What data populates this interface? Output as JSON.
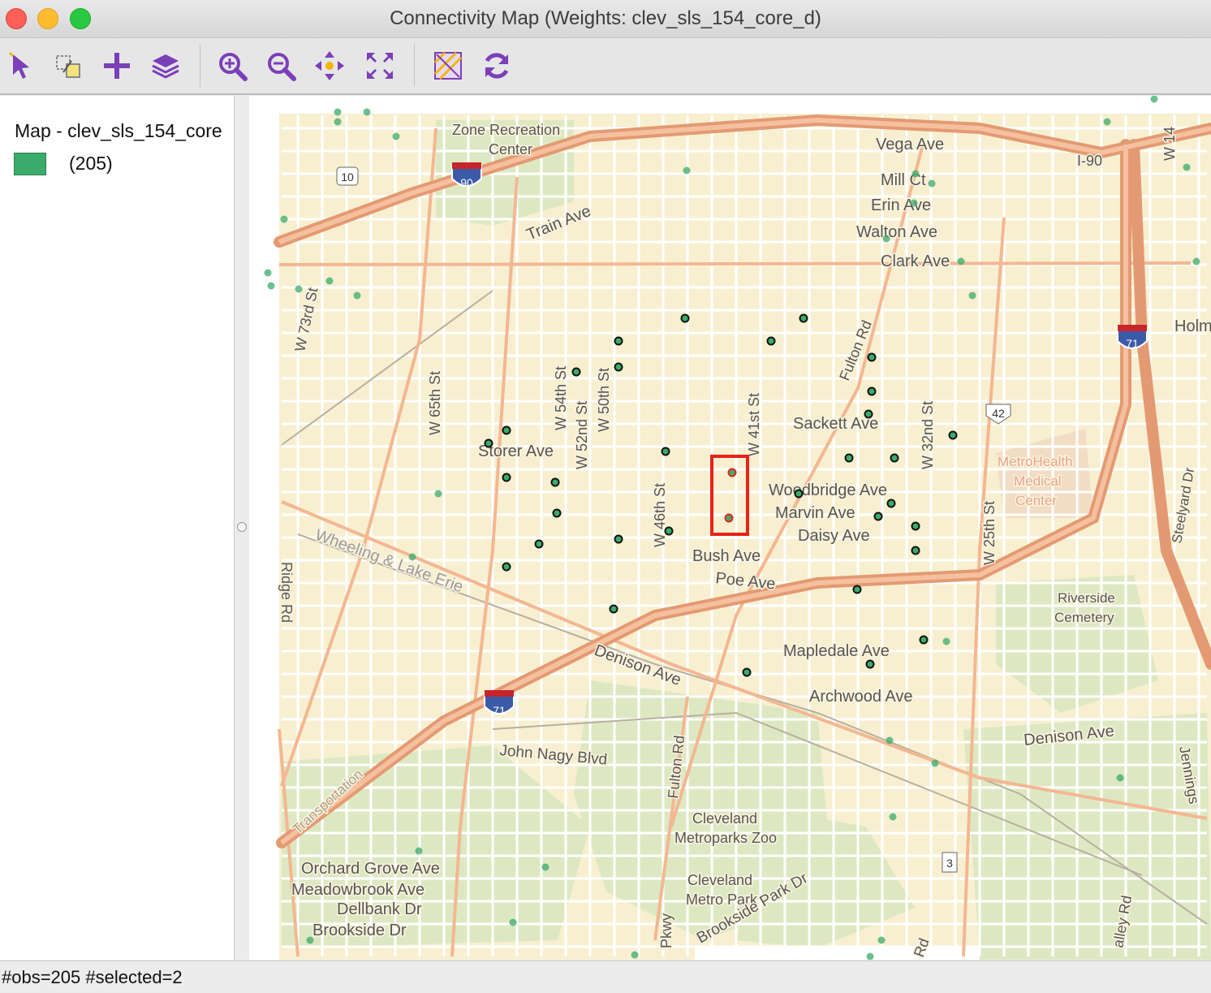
{
  "window": {
    "title": "Connectivity Map (Weights: clev_sls_154_core_d)"
  },
  "toolbar": {
    "buttons": [
      {
        "name": "select-pointer",
        "icon": "pointer-icon"
      },
      {
        "name": "selection-shape",
        "icon": "select-shape-icon"
      },
      {
        "name": "add",
        "icon": "plus-icon"
      },
      {
        "name": "layers",
        "icon": "layers-icon"
      },
      {
        "name": "zoom-in",
        "icon": "zoom-in-icon"
      },
      {
        "name": "zoom-out",
        "icon": "zoom-out-icon"
      },
      {
        "name": "pan",
        "icon": "pan-icon"
      },
      {
        "name": "full-extent",
        "icon": "full-extent-icon"
      },
      {
        "name": "basemap",
        "icon": "basemap-icon"
      },
      {
        "name": "refresh",
        "icon": "refresh-icon"
      }
    ],
    "icon_color": "#7b3fb8"
  },
  "legend": {
    "title": "Map - clev_sls_154_core",
    "items": [
      {
        "label": "(205)",
        "color": "#3aab6a"
      }
    ]
  },
  "map": {
    "street_labels": [
      "Zone Recreation",
      "Center",
      "Vega Ave",
      "I-90",
      "Mill Ct",
      "Erin Ave",
      "Walton Ave",
      "Clark Ave",
      "Train Ave",
      "10",
      "90",
      "71",
      "42",
      "3",
      "Holm",
      "W 73rd St",
      "W 65th St",
      "W 54th St",
      "W 52nd St",
      "W 50th St",
      "W 46th St",
      "W 41st St",
      "W 32nd St",
      "W 25th St",
      "Fulton Rd",
      "Storer Ave",
      "Sackett Ave",
      "Woodbridge Ave",
      "Marvin Ave",
      "Daisy Ave",
      "Bush Ave",
      "Poe Ave",
      "MetroHealth",
      "Medical",
      "Center",
      "Steelyard Dr",
      "Wheeling & Lake Erie",
      "Ridge Rd",
      "Denison Ave",
      "Mapledale Ave",
      "Archwood Ave",
      "Riverside",
      "Cemetery",
      "John Nagy Blvd",
      "Transportation",
      "Cleveland",
      "Metroparks Zoo",
      "Metro Park",
      "Brookside Park Dr",
      "Orchard Grove Ave",
      "Meadowbrook Ave",
      "Dellbank Dr",
      "Brookside Dr",
      "Jennings",
      "Pkwy",
      "W 14",
      "Rd",
      "alley Rd"
    ],
    "selection_color": "#e8231a",
    "point_color": "#3aab6a"
  },
  "status": {
    "text": "#obs=205 #selected=2"
  }
}
